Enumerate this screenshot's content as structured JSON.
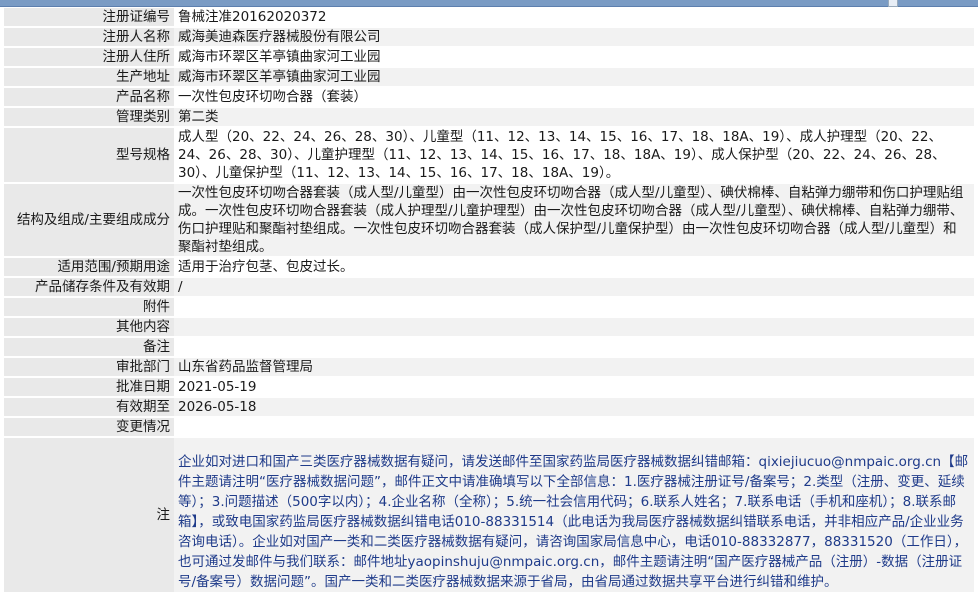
{
  "header": {
    "title": "",
    "close_icon": "close-icon"
  },
  "rows": [
    {
      "label": "注册证编号",
      "value": "鲁械注准20162020372"
    },
    {
      "label": "注册人名称",
      "value": "威海美迪森医疗器械股份有限公司"
    },
    {
      "label": "注册人住所",
      "value": "威海市环翠区羊亭镇曲家河工业园"
    },
    {
      "label": "生产地址",
      "value": "威海市环翠区羊亭镇曲家河工业园"
    },
    {
      "label": "产品名称",
      "value": "一次性包皮环切吻合器（套装）"
    },
    {
      "label": "管理类别",
      "value": "第二类"
    },
    {
      "label": "型号规格",
      "value": "成人型（20、22、24、26、28、30）、儿童型（11、12、13、14、15、16、17、18、18A、19）、成人护理型（20、22、24、26、28、30）、儿童护理型（11、12、13、14、15、16、17、18、18A、19）、成人保护型（20、22、24、26、28、30）、儿童保护型（11、12、13、14、15、16、17、18、18A、19）。"
    },
    {
      "label": "结构及组成/主要组成成分",
      "value": "一次性包皮环切吻合器套装（成人型/儿童型）由一次性包皮环切吻合器（成人型/儿童型）、碘伏棉棒、自粘弹力绷带和伤口护理贴组成。一次性包皮环切吻合器套装（成人护理型/儿童护理型）由一次性包皮环切吻合器（成人型/儿童型）、碘伏棉棒、自粘弹力绷带、伤口护理贴和聚酯衬垫组成。一次性包皮环切吻合器套装（成人保护型/儿童保护型）由一次性包皮环切吻合器（成人型/儿童型）和聚酯衬垫组成。"
    },
    {
      "label": "适用范围/预期用途",
      "value": "适用于治疗包茎、包皮过长。"
    },
    {
      "label": "产品储存条件及有效期",
      "value": "/"
    },
    {
      "label": "附件",
      "value": ""
    },
    {
      "label": "其他内容",
      "value": ""
    },
    {
      "label": "备注",
      "value": ""
    },
    {
      "label": "审批部门",
      "value": "山东省药品监督管理局"
    },
    {
      "label": "批准日期",
      "value": "2021-05-19"
    },
    {
      "label": "有效期至",
      "value": "2026-05-18"
    },
    {
      "label": "变更情况",
      "value": ""
    }
  ],
  "note": {
    "label": "注",
    "text": "企业如对进口和国产三类医疗器械数据有疑问，请发送邮件至国家药监局医疗器械数据纠错邮箱：qixiejiucuo@nmpaic.org.cn【邮件主题请注明“医疗器械数据问题”，邮件正文中请准确填写以下全部信息：1.医疗器械注册证号/备案号；2.类型（注册、变更、延续等）；3.问题描述（500字以内）；4.企业名称（全称）；5.统一社会信用代码；6.联系人姓名；7.联系电话（手机和座机）；8.联系邮箱】，或致电国家药监局医疗器械数据纠错电话010-88331514（此电话为我局医疗器械数据纠错联系电话，并非相应产品/企业业务咨询电话）。企业如对国产一类和二类医疗器械数据有疑问，请咨询国家局信息中心，电话010-88332877，88331520（工作日），也可通过发邮件与我们联系：邮件地址yaopinshuju@nmpaic.org.cn，邮件主题请注明“国产医疗器械产品（注册）-数据（注册证号/备案号）数据问题”。国产一类和二类医疗器械数据来源于省局，由省局通过数据共享平台进行纠错和维护。"
  }
}
